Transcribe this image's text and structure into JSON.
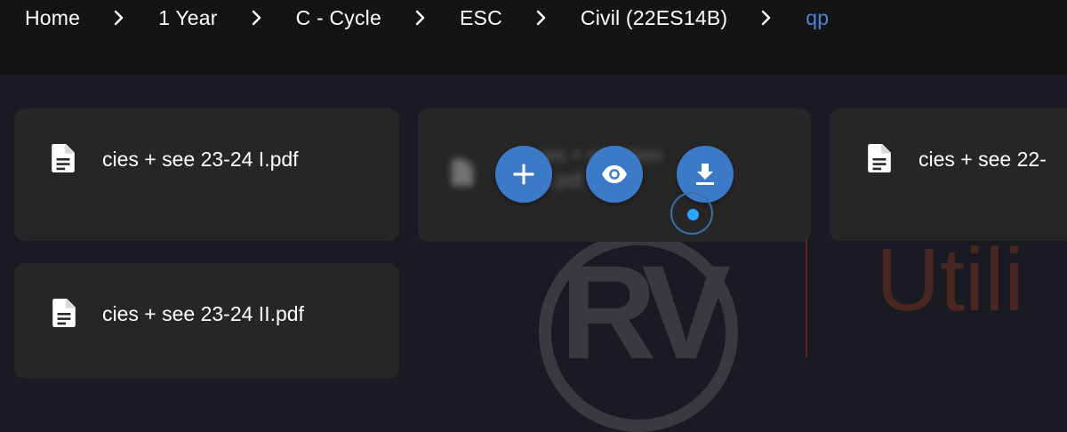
{
  "breadcrumb": {
    "items": [
      {
        "label": "Home"
      },
      {
        "label": "1 Year"
      },
      {
        "label": "C - Cycle"
      },
      {
        "label": "ESC"
      },
      {
        "label": "Civil (22ES14B)"
      },
      {
        "label": "qp"
      }
    ],
    "separator_icon": "chevron-right-icon"
  },
  "files": [
    {
      "name": "cies + see 23-24 I.pdf",
      "icon": "file-document-icon"
    },
    {
      "name": "cies + see 22-",
      "icon": "file-document-icon"
    },
    {
      "name": "cies + see 23-24 II.pdf",
      "icon": "file-document-icon"
    }
  ],
  "hover_card": {
    "blurred_line1": "ies + question",
    "blurred_line2": "s.pdf",
    "actions": [
      {
        "icon": "plus-icon"
      },
      {
        "icon": "eye-icon"
      },
      {
        "icon": "download-icon"
      }
    ]
  },
  "watermark": {
    "logo_text": "RV",
    "side_text": "Utili"
  },
  "colors": {
    "background": "#1a1a22",
    "topbar": "#141414",
    "card": "#262626",
    "accent": "#3b7ac7",
    "breadcrumb_current": "#4a86d8"
  }
}
